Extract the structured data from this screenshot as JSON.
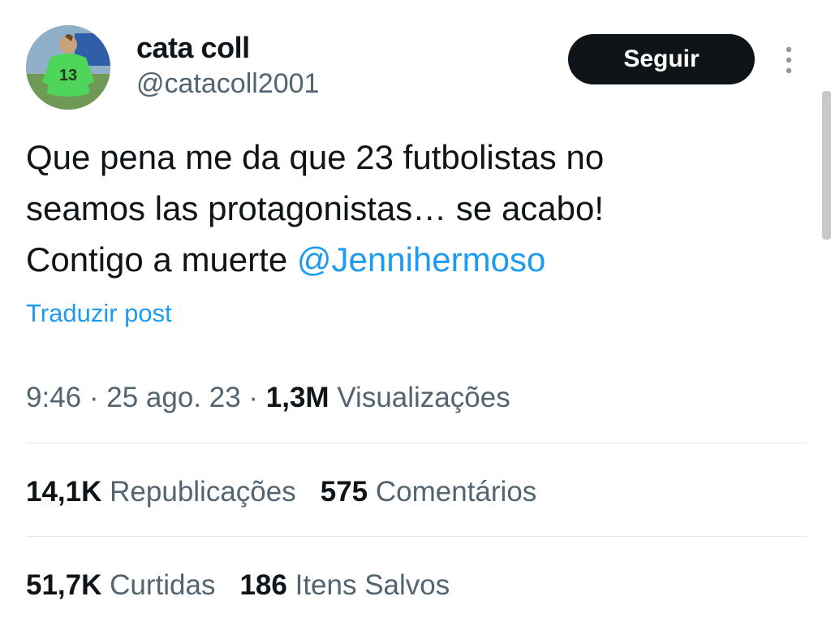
{
  "user": {
    "display_name": "cata coll",
    "handle": "@catacoll2001",
    "avatar_jersey_number": "13"
  },
  "header": {
    "follow_label": "Seguir",
    "more_icon": "more-vertical-icon"
  },
  "tweet": {
    "text_line1": "Que pena me da que 23 futbolistas no",
    "text_line2": "seamos las protagonistas… se acabo!",
    "text_line3_prefix": "Contigo a muerte ",
    "mention": "@Jennihermoso",
    "translate_label": "Traduzir post"
  },
  "meta": {
    "time": "9:46",
    "separator": " · ",
    "date": "25 ago. 23",
    "views_count": "1,3M",
    "views_label": "Visualizações"
  },
  "stats": {
    "reposts_count": "14,1K",
    "reposts_label": "Republicações",
    "comments_count": "575",
    "comments_label": "Comentários",
    "likes_count": "51,7K",
    "likes_label": "Curtidas",
    "bookmarks_count": "186",
    "bookmarks_label": "Itens Salvos"
  },
  "colors": {
    "text_primary": "#0f1419",
    "text_secondary": "#536471",
    "link": "#1d9bf0",
    "button_bg": "#0f1419",
    "divider": "#e1e6ea"
  }
}
